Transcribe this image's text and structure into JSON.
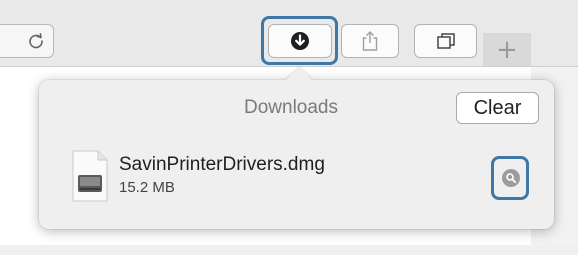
{
  "toolbar": {
    "reload_icon": "reload-icon",
    "download_icon": "download-arrow-circle-icon",
    "share_icon": "share-icon",
    "tabs_icon": "tab-overview-icon",
    "new_tab_label": "+"
  },
  "downloads": {
    "title": "Downloads",
    "clear_label": "Clear",
    "items": [
      {
        "name": "SavinPrinterDrivers.dmg",
        "size": "15.2 MB",
        "file_icon": "dmg-file-icon",
        "action_icon": "magnifier-reveal-icon"
      }
    ]
  },
  "colors": {
    "highlight": "#3f77a6",
    "popover_bg": "#efefef",
    "toolbar_bg": "#e9e9e9"
  }
}
